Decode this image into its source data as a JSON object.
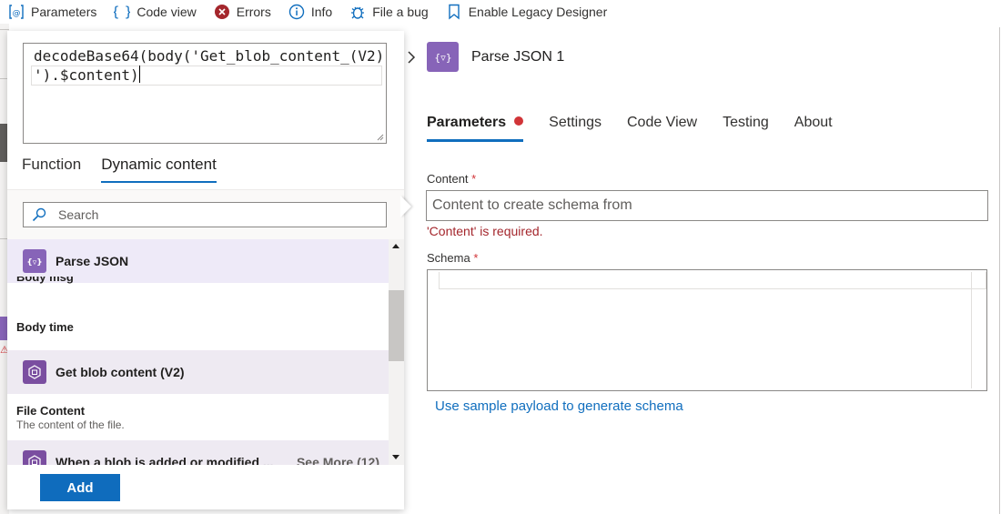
{
  "toolbar": {
    "items": [
      {
        "label": "Parameters",
        "icon": "parameters-icon"
      },
      {
        "label": "Code view",
        "icon": "code-braces-icon"
      },
      {
        "label": "Errors",
        "icon": "error-circle-icon"
      },
      {
        "label": "Info",
        "icon": "info-icon"
      },
      {
        "label": "File a bug",
        "icon": "bug-icon"
      },
      {
        "label": "Enable Legacy Designer",
        "icon": "bookmark-icon"
      }
    ]
  },
  "popup": {
    "expression_line1": "decodeBase64(body('Get_blob_content_(V2)",
    "expression_line2": "').$content)",
    "tabs": [
      "Function",
      "Dynamic content"
    ],
    "active_tab": "Dynamic content",
    "search_placeholder": "Search",
    "groups": {
      "parse_json": {
        "title": "Parse JSON",
        "icon": "parse-json-icon"
      },
      "get_blob": {
        "title": "Get blob content (V2)",
        "icon": "blob-icon"
      },
      "when_blob": {
        "title": "When a blob is added or modified ...",
        "icon": "blob-icon",
        "see_more": "See More (12)"
      }
    },
    "items": {
      "body_msg": "Body msg",
      "body_time": "Body time",
      "file_content_title": "File Content",
      "file_content_desc": "The content of the file."
    },
    "add_label": "Add"
  },
  "action": {
    "title": "Parse JSON 1",
    "tabs": [
      "Parameters",
      "Settings",
      "Code View",
      "Testing",
      "About"
    ],
    "active_tab": "Parameters",
    "content_label": "Content",
    "content_required": "*",
    "content_placeholder": "Content to create schema from",
    "content_error": "'Content' is required.",
    "schema_label": "Schema",
    "schema_required": "*",
    "sample_link": "Use sample payload to generate schema"
  },
  "colors": {
    "accent": "#0f6cbd",
    "error": "#d13438",
    "action_purple": "#8764b8"
  }
}
